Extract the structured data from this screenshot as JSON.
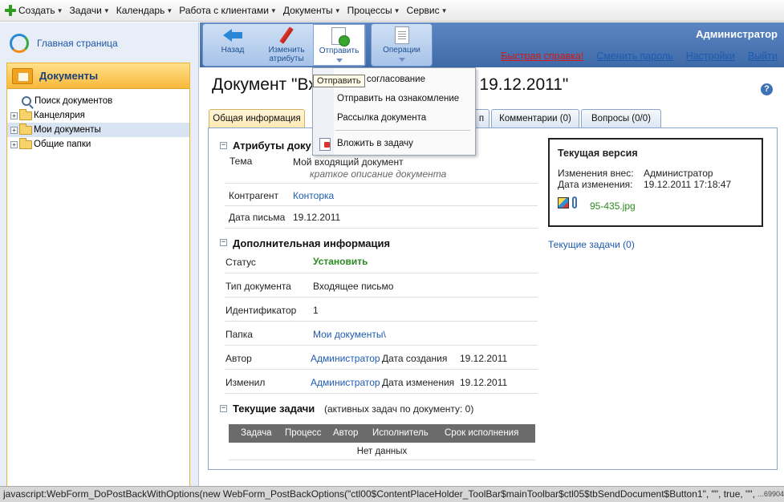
{
  "menubar": {
    "items": [
      {
        "label": "Создать",
        "icon": "plus-icon"
      },
      {
        "label": "Задачи"
      },
      {
        "label": "Календарь"
      },
      {
        "label": "Работа с клиентами"
      },
      {
        "label": "Документы"
      },
      {
        "label": "Процессы"
      },
      {
        "label": "Сервис"
      }
    ]
  },
  "sidebar": {
    "home_label": "Главная страница",
    "panel_title": "Документы",
    "tree": [
      {
        "label": "Поиск документов",
        "icon": "magnifier-icon"
      },
      {
        "label": "Канцелярия",
        "icon": "folder-icon",
        "expandable": true
      },
      {
        "label": "Мои документы",
        "icon": "folder-icon",
        "expandable": true,
        "selected": true
      },
      {
        "label": "Общие папки",
        "icon": "folder-icon",
        "expandable": true
      }
    ]
  },
  "toolbar": {
    "back_label": "Назад",
    "edit_label": "Изменить атрибуты",
    "send_label": "Отправить",
    "ops_label": "Операции"
  },
  "header": {
    "user": "Администратор",
    "links": {
      "quick_help": "Быстрая справка!",
      "change_password": "Сменить пароль",
      "settings": "Настройки",
      "logout": "Выйти"
    }
  },
  "send_menu": {
    "tooltip": "Отправить",
    "items": [
      "ить на согласование",
      "Отправить на ознакомление",
      "Рассылка документа",
      "Вложить в задачу"
    ]
  },
  "page": {
    "title": "Документ \"Вх",
    "title_tail": "от 19.12.2011\""
  },
  "tabs": {
    "general": "Общая информация",
    "hidden_tab_tail": "п",
    "comments": "Комментарии (0)",
    "questions": "Вопросы (0/0)"
  },
  "attributes": {
    "section_title": "Атрибуты доку",
    "subject_label": "Тема",
    "subject_value": "Мой входящий документ",
    "subject_hint": "краткое описание документа",
    "counterparty_label": "Контрагент",
    "counterparty_value": "Конторка",
    "letter_date_label": "Дата письма",
    "letter_date_value": "19.12.2011"
  },
  "additional": {
    "section_title": "Дополнительная информация",
    "status_label": "Статус",
    "status_value": "Установить",
    "doctype_label": "Тип документа",
    "doctype_value": "Входящее письмо",
    "id_label": "Идентификатор",
    "id_value": "1",
    "folder_label": "Папка",
    "folder_value": "Мои документы\\",
    "author_label": "Автор",
    "author_value": "Администратор",
    "created_label": "Дата создания",
    "created_value": "19.12.2011",
    "changed_by_label": "Изменил",
    "changed_by_value": "Администратор",
    "changed_label": "Дата изменения",
    "changed_value": "19.12.2011"
  },
  "version": {
    "title": "Текущая версия",
    "changed_by_label": "Изменения внес:",
    "changed_by_value": "Администратор",
    "date_label": "Дата изменения:",
    "date_value": "19.12.2011 17:18:47",
    "file_name": "95-435.jpg",
    "current_tasks_link": "Текущие задачи (0)"
  },
  "tasks": {
    "section_title": "Текущие задачи",
    "subtitle": "(активных задач по документу: 0)",
    "columns": [
      "Задача",
      "Процесс",
      "Автор",
      "Исполнитель",
      "Срок исполнения"
    ],
    "empty_text": "Нет данных"
  },
  "statusbar": {
    "text": "javascript:WebForm_DoPostBackWithOptions(new WebForm_PostBackOptions(\"ctl00$ContentPlaceHolder_ToolBar$mainToolbar$ctl05$tbSendDocument$Button1\", \"\", true, \"\", \"",
    "suffix": "...69904"
  }
}
